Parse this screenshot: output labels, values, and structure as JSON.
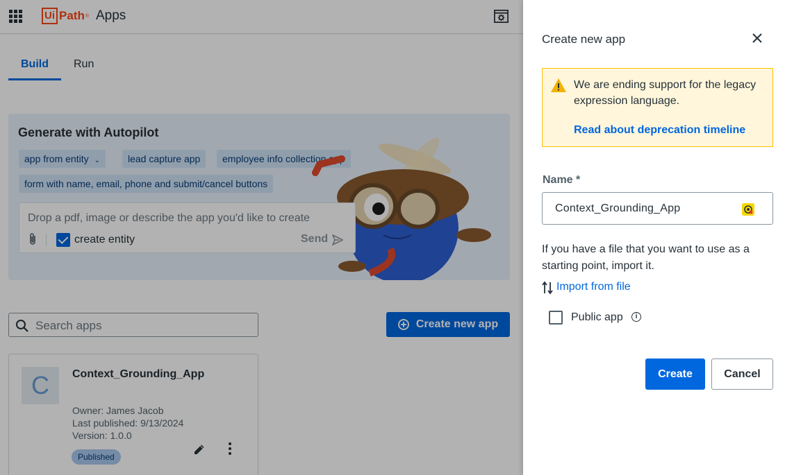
{
  "header": {
    "logo_ui": "Ui",
    "logo_path": "Path",
    "logo_tm": "®",
    "app_title": "Apps"
  },
  "tabs": [
    {
      "label": "Build",
      "active": true
    },
    {
      "label": "Run",
      "active": false
    }
  ],
  "autopilot": {
    "title": "Generate with Autopilot",
    "chips": [
      "app from entity",
      "lead capture app",
      "employee info collection app",
      "form with name, email, phone and submit/cancel buttons"
    ],
    "prompt_placeholder": "Drop a pdf, image or describe the app you'd like to create",
    "create_entity_label": "create entity",
    "create_entity_checked": true,
    "send_label": "Send"
  },
  "search": {
    "placeholder": "Search apps"
  },
  "create_new_app_button": "Create new app",
  "app_card": {
    "avatar_letter": "C",
    "name": "Context_Grounding_App",
    "owner": "Owner: James Jacob",
    "last_published": "Last published: 9/13/2024",
    "version": "Version: 1.0.0",
    "status": "Published"
  },
  "panel": {
    "title": "Create new app",
    "warning_text": "We are ending support for the legacy expression language.",
    "warning_link": "Read about deprecation timeline",
    "name_label": "Name *",
    "name_value": "Context_Grounding_App",
    "help_text": "If you have a file that you want to use as a starting point, import it.",
    "import_link": "Import from file",
    "public_app_label": "Public app",
    "public_app_checked": false,
    "create_button": "Create",
    "cancel_button": "Cancel"
  },
  "colors": {
    "primary": "#0067df",
    "brand": "#fa4616",
    "warning_bg": "#fff6db",
    "warning_border": "#ffc000"
  }
}
